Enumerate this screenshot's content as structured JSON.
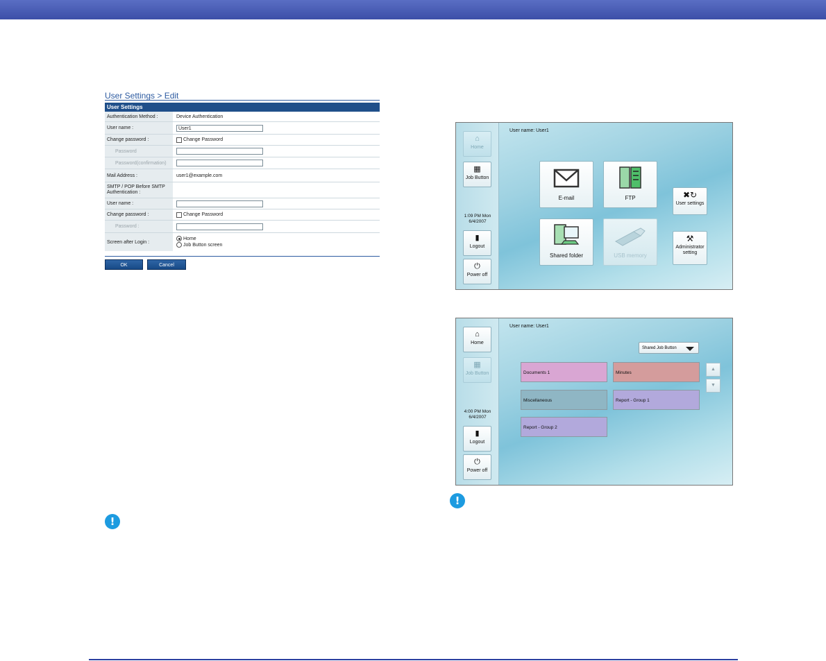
{
  "web_form": {
    "title": "User Settings > Edit",
    "section_header": "User Settings",
    "rows": {
      "auth_method": {
        "label": "Authentication Method :",
        "value": "Device Authentication"
      },
      "user_name": {
        "label": "User name :",
        "value": "User1"
      },
      "change_password": {
        "label": "Change password :",
        "checkbox_label": "Change Password"
      },
      "password": {
        "label": "Password"
      },
      "password_confirm": {
        "label": "Password(confirmation)"
      },
      "mail_address": {
        "label": "Mail Address :",
        "value": "user1@example.com"
      },
      "smtp_heading": {
        "label": "SMTP / POP Before SMTP Authentication :"
      },
      "smtp_user_name": {
        "label": "User name :"
      },
      "smtp_change_password": {
        "label": "Change password :",
        "checkbox_label": "Change Password"
      },
      "smtp_password": {
        "label": "Password :"
      },
      "screen_after_login": {
        "label": "Screen after Login :",
        "options": [
          "Home",
          "Job Button screen"
        ],
        "selected": "Home"
      }
    },
    "ok_label": "OK",
    "cancel_label": "Cancel"
  },
  "home_screen": {
    "user_name": "User name: User1",
    "sidebar": {
      "home": "Home",
      "job_button": "Job Button",
      "time": "1:09 PM  Mon",
      "date": "6/4/2007",
      "logout": "Logout",
      "power_off": "Power off"
    },
    "tiles": {
      "email": "E-mail",
      "ftp": "FTP",
      "shared_folder": "Shared folder",
      "usb_memory": "USB memory",
      "user_settings": "User settings",
      "administrator_setting": "Administrator setting"
    }
  },
  "job_screen": {
    "user_name": "User name: User1",
    "sidebar": {
      "home": "Home",
      "job_button": "Job Button",
      "time": "4:00 PM  Mon",
      "date": "6/4/2007",
      "logout": "Logout",
      "power_off": "Power off"
    },
    "dropdown_selected": "Shared Job Button",
    "jobs": [
      {
        "label": "Documents 1",
        "color": "#d9a6d3"
      },
      {
        "label": "Minutes",
        "color": "#d49c9c"
      },
      {
        "label": "Miscellaneous",
        "color": "#8fb6c4"
      },
      {
        "label": "Report - Group 1",
        "color": "#b2a9dc"
      },
      {
        "label": "Report - Group 2",
        "color": "#b2a9dc"
      }
    ]
  },
  "colors": {
    "top_bar": "#3c4fa8",
    "form_header": "#1f4f8a",
    "notice_icon": "#1d9be0"
  },
  "icons": [
    "home-icon",
    "job-button-icon",
    "logout-icon",
    "power-icon",
    "mail-icon",
    "ftp-server-icon",
    "shared-folder-icon",
    "usb-memory-icon",
    "user-settings-icon",
    "administrator-tools-icon",
    "dropdown-arrow-icon",
    "scroll-up-icon",
    "scroll-down-icon",
    "notice-icon"
  ]
}
